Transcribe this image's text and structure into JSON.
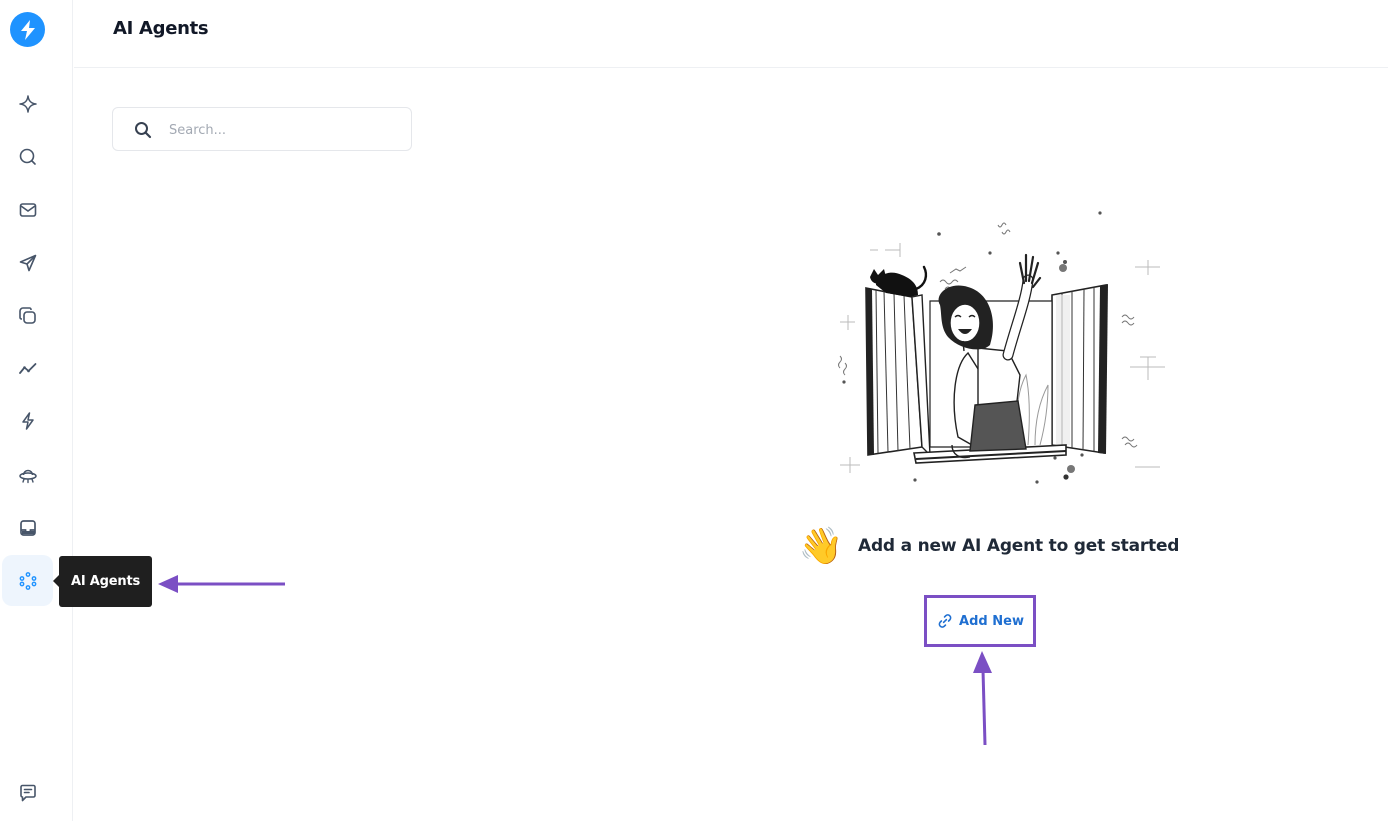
{
  "app": {
    "title": "AI Agents"
  },
  "sidebar": {
    "logo_icon": "bolt-icon",
    "items": [
      {
        "icon": "sparkle-icon"
      },
      {
        "icon": "chat-search-icon"
      },
      {
        "icon": "mail-icon"
      },
      {
        "icon": "send-icon"
      },
      {
        "icon": "copy-icon"
      },
      {
        "icon": "analytics-icon"
      },
      {
        "icon": "lightning-icon"
      },
      {
        "icon": "ufo-icon"
      },
      {
        "icon": "inbox-icon"
      },
      {
        "icon": "ai-agents-icon",
        "active": true
      },
      {
        "icon": "feedback-icon"
      }
    ],
    "tooltip": "AI Agents"
  },
  "search": {
    "placeholder": "Search..."
  },
  "empty_state": {
    "emoji": "👋",
    "message": "Add a new AI Agent to get started",
    "button_label": "Add New"
  },
  "colors": {
    "accent": "#1f93ff",
    "link": "#1f6fd1",
    "annotation": "#7b4fc4",
    "tooltip_bg": "#1f1f1f"
  }
}
